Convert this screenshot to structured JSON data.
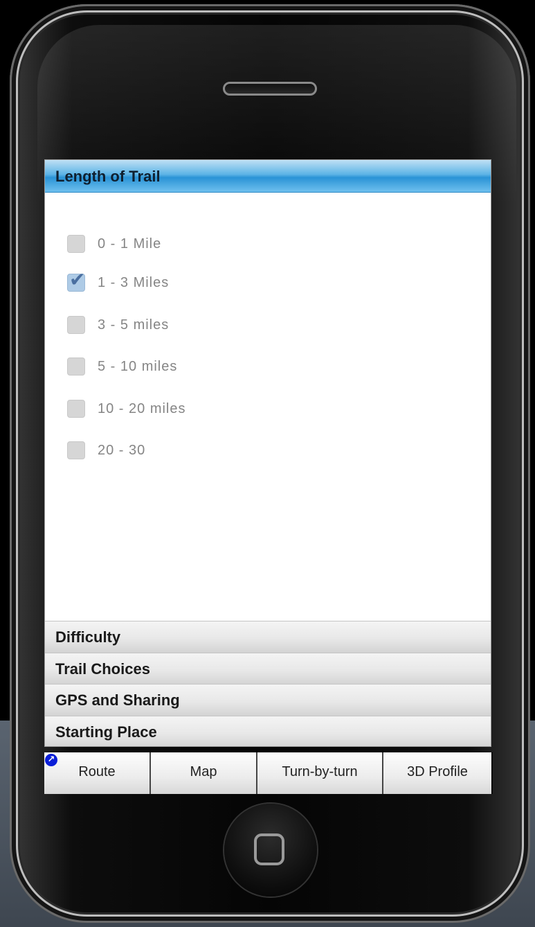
{
  "accordion": {
    "active_section": {
      "title": "Length of Trail",
      "options": [
        {
          "label": "0 - 1 Mile",
          "checked": false
        },
        {
          "label": "1 - 3 Miles",
          "checked": true
        },
        {
          "label": "3 - 5 miles",
          "checked": false
        },
        {
          "label": "5 - 10 miles",
          "checked": false
        },
        {
          "label": "10 - 20 miles",
          "checked": false
        },
        {
          "label": "20 - 30",
          "checked": false
        }
      ]
    },
    "sections": [
      {
        "title": "Difficulty"
      },
      {
        "title": "Trail Choices"
      },
      {
        "title": "GPS and Sharing"
      },
      {
        "title": "Starting Place"
      }
    ]
  },
  "tabbar": {
    "tabs": [
      {
        "label": "Route",
        "icon": "external-link-icon"
      },
      {
        "label": "Map"
      },
      {
        "label": "Turn-by-turn"
      },
      {
        "label": "3D Profile"
      }
    ]
  },
  "colors": {
    "active_header": "#2a93d6",
    "checkbox_checked": "#aecbe6"
  }
}
